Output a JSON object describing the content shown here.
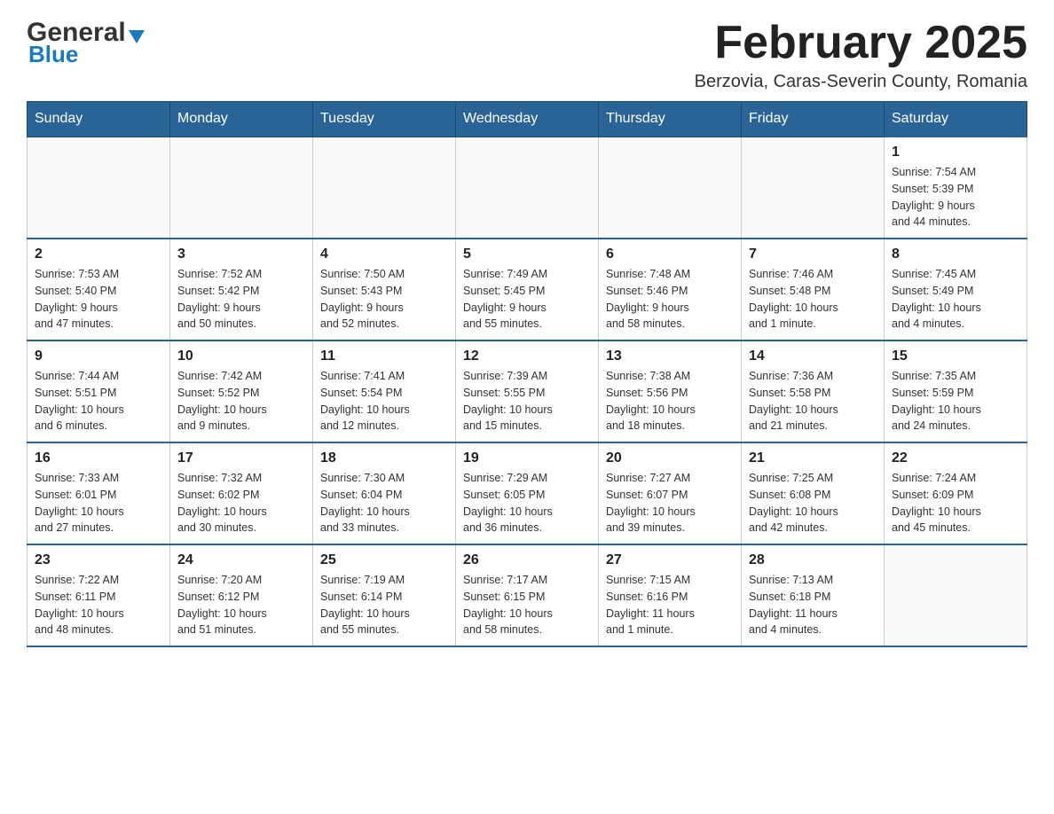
{
  "header": {
    "title": "February 2025",
    "location": "Berzovia, Caras-Severin County, Romania",
    "logo_general": "General",
    "logo_blue": "Blue"
  },
  "days_of_week": [
    "Sunday",
    "Monday",
    "Tuesday",
    "Wednesday",
    "Thursday",
    "Friday",
    "Saturday"
  ],
  "weeks": [
    {
      "days": [
        {
          "number": "",
          "info": ""
        },
        {
          "number": "",
          "info": ""
        },
        {
          "number": "",
          "info": ""
        },
        {
          "number": "",
          "info": ""
        },
        {
          "number": "",
          "info": ""
        },
        {
          "number": "",
          "info": ""
        },
        {
          "number": "1",
          "info": "Sunrise: 7:54 AM\nSunset: 5:39 PM\nDaylight: 9 hours\nand 44 minutes."
        }
      ]
    },
    {
      "days": [
        {
          "number": "2",
          "info": "Sunrise: 7:53 AM\nSunset: 5:40 PM\nDaylight: 9 hours\nand 47 minutes."
        },
        {
          "number": "3",
          "info": "Sunrise: 7:52 AM\nSunset: 5:42 PM\nDaylight: 9 hours\nand 50 minutes."
        },
        {
          "number": "4",
          "info": "Sunrise: 7:50 AM\nSunset: 5:43 PM\nDaylight: 9 hours\nand 52 minutes."
        },
        {
          "number": "5",
          "info": "Sunrise: 7:49 AM\nSunset: 5:45 PM\nDaylight: 9 hours\nand 55 minutes."
        },
        {
          "number": "6",
          "info": "Sunrise: 7:48 AM\nSunset: 5:46 PM\nDaylight: 9 hours\nand 58 minutes."
        },
        {
          "number": "7",
          "info": "Sunrise: 7:46 AM\nSunset: 5:48 PM\nDaylight: 10 hours\nand 1 minute."
        },
        {
          "number": "8",
          "info": "Sunrise: 7:45 AM\nSunset: 5:49 PM\nDaylight: 10 hours\nand 4 minutes."
        }
      ]
    },
    {
      "days": [
        {
          "number": "9",
          "info": "Sunrise: 7:44 AM\nSunset: 5:51 PM\nDaylight: 10 hours\nand 6 minutes."
        },
        {
          "number": "10",
          "info": "Sunrise: 7:42 AM\nSunset: 5:52 PM\nDaylight: 10 hours\nand 9 minutes."
        },
        {
          "number": "11",
          "info": "Sunrise: 7:41 AM\nSunset: 5:54 PM\nDaylight: 10 hours\nand 12 minutes."
        },
        {
          "number": "12",
          "info": "Sunrise: 7:39 AM\nSunset: 5:55 PM\nDaylight: 10 hours\nand 15 minutes."
        },
        {
          "number": "13",
          "info": "Sunrise: 7:38 AM\nSunset: 5:56 PM\nDaylight: 10 hours\nand 18 minutes."
        },
        {
          "number": "14",
          "info": "Sunrise: 7:36 AM\nSunset: 5:58 PM\nDaylight: 10 hours\nand 21 minutes."
        },
        {
          "number": "15",
          "info": "Sunrise: 7:35 AM\nSunset: 5:59 PM\nDaylight: 10 hours\nand 24 minutes."
        }
      ]
    },
    {
      "days": [
        {
          "number": "16",
          "info": "Sunrise: 7:33 AM\nSunset: 6:01 PM\nDaylight: 10 hours\nand 27 minutes."
        },
        {
          "number": "17",
          "info": "Sunrise: 7:32 AM\nSunset: 6:02 PM\nDaylight: 10 hours\nand 30 minutes."
        },
        {
          "number": "18",
          "info": "Sunrise: 7:30 AM\nSunset: 6:04 PM\nDaylight: 10 hours\nand 33 minutes."
        },
        {
          "number": "19",
          "info": "Sunrise: 7:29 AM\nSunset: 6:05 PM\nDaylight: 10 hours\nand 36 minutes."
        },
        {
          "number": "20",
          "info": "Sunrise: 7:27 AM\nSunset: 6:07 PM\nDaylight: 10 hours\nand 39 minutes."
        },
        {
          "number": "21",
          "info": "Sunrise: 7:25 AM\nSunset: 6:08 PM\nDaylight: 10 hours\nand 42 minutes."
        },
        {
          "number": "22",
          "info": "Sunrise: 7:24 AM\nSunset: 6:09 PM\nDaylight: 10 hours\nand 45 minutes."
        }
      ]
    },
    {
      "days": [
        {
          "number": "23",
          "info": "Sunrise: 7:22 AM\nSunset: 6:11 PM\nDaylight: 10 hours\nand 48 minutes."
        },
        {
          "number": "24",
          "info": "Sunrise: 7:20 AM\nSunset: 6:12 PM\nDaylight: 10 hours\nand 51 minutes."
        },
        {
          "number": "25",
          "info": "Sunrise: 7:19 AM\nSunset: 6:14 PM\nDaylight: 10 hours\nand 55 minutes."
        },
        {
          "number": "26",
          "info": "Sunrise: 7:17 AM\nSunset: 6:15 PM\nDaylight: 10 hours\nand 58 minutes."
        },
        {
          "number": "27",
          "info": "Sunrise: 7:15 AM\nSunset: 6:16 PM\nDaylight: 11 hours\nand 1 minute."
        },
        {
          "number": "28",
          "info": "Sunrise: 7:13 AM\nSunset: 6:18 PM\nDaylight: 11 hours\nand 4 minutes."
        },
        {
          "number": "",
          "info": ""
        }
      ]
    }
  ]
}
